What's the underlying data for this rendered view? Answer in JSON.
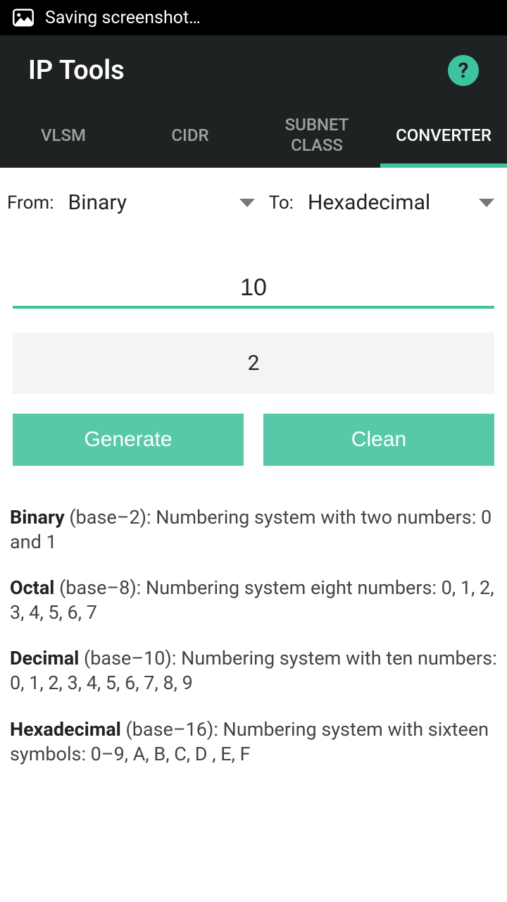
{
  "statusbar": {
    "text": "Saving screenshot…"
  },
  "header": {
    "title": "IP Tools",
    "help": "?"
  },
  "tabs": [
    {
      "label": "VLSM",
      "active": false
    },
    {
      "label": "CIDR",
      "active": false
    },
    {
      "label": "SUBNET CLASS",
      "active": false
    },
    {
      "label": "CONVERTER",
      "active": true
    }
  ],
  "converter": {
    "from_label": "From:",
    "to_label": "To:",
    "from_value": "Binary",
    "to_value": "Hexadecimal",
    "input": "10",
    "output": "2",
    "generate": "Generate",
    "clean": "Clean"
  },
  "info": {
    "binary_term": "Binary",
    "binary_rest": " (base–2): Numbering system with two numbers: 0 and 1",
    "octal_term": " Octal",
    "octal_rest": " (base–8): Numbering system eight numbers: 0, 1, 2, 3, 4, 5, 6, 7",
    "decimal_term": " Decimal",
    "decimal_rest": " (base–10): Numbering system with ten numbers: 0, 1, 2, 3, 4, 5, 6, 7, 8, 9",
    "hex_term": " Hexadecimal",
    "hex_rest": " (base–16): Numbering system with sixteen symbols: 0–9, A, B, C, D , E, F"
  }
}
